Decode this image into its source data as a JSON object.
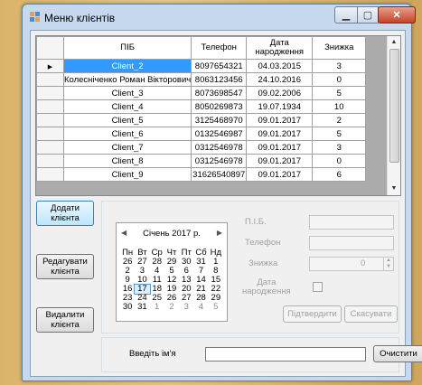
{
  "window": {
    "title": "Меню клієнтів"
  },
  "table": {
    "columns": [
      "ПІБ",
      "Телефон",
      "Дата\nнародження",
      "Знижка"
    ],
    "rows": [
      {
        "name": "Client_2",
        "phone": "8097654321",
        "birth": "04.03.2015",
        "discount": "3",
        "selected": true
      },
      {
        "name": "Колесніченко Роман Вікторович",
        "phone": "8063123456",
        "birth": "24.10.2016",
        "discount": "0"
      },
      {
        "name": "Client_3",
        "phone": "8073698547",
        "birth": "09.02.2006",
        "discount": "5"
      },
      {
        "name": "Client_4",
        "phone": "8050269873",
        "birth": "19.07.1934",
        "discount": "10"
      },
      {
        "name": "Client_5",
        "phone": "3125468970",
        "birth": "09.01.2017",
        "discount": "2"
      },
      {
        "name": "Client_6",
        "phone": "0132546987",
        "birth": "09.01.2017",
        "discount": "5"
      },
      {
        "name": "Client_7",
        "phone": "0312546978",
        "birth": "09.01.2017",
        "discount": "3"
      },
      {
        "name": "Client_8",
        "phone": "0312546978",
        "birth": "09.01.2017",
        "discount": "0"
      },
      {
        "name": "Client_9",
        "phone": "31626540897",
        "birth": "09.01.2017",
        "discount": "6"
      }
    ]
  },
  "buttons": {
    "add": "Додати\nклієнта",
    "edit": "Редагувати\nклієнта",
    "delete": "Видалити\nклієнта",
    "confirm": "Підтвердити",
    "cancel": "Скасувати",
    "clear": "Очистити"
  },
  "calendar": {
    "month": "Січень 2017 р.",
    "weekdays": [
      "Пн",
      "Вт",
      "Ср",
      "Чт",
      "Пт",
      "Сб",
      "Нд"
    ],
    "weeks": [
      [
        "26",
        "27",
        "28",
        "29",
        "30",
        "31",
        "1"
      ],
      [
        "2",
        "3",
        "4",
        "5",
        "6",
        "7",
        "8"
      ],
      [
        "9",
        "10",
        "11",
        "12",
        "13",
        "14",
        "15"
      ],
      [
        "16",
        "17",
        "18",
        "19",
        "20",
        "21",
        "22"
      ],
      [
        "23",
        "24",
        "25",
        "26",
        "27",
        "28",
        "29"
      ],
      [
        "30",
        "31",
        "1",
        "2",
        "3",
        "4",
        "5"
      ]
    ],
    "today": "17"
  },
  "form": {
    "pib_label": "П.І.Б.",
    "phone_label": "Телефон",
    "discount_label": "Знижка",
    "discount_value": "0",
    "birth_label": "Дата\nнародження"
  },
  "search": {
    "label": "Введіть ім'я",
    "value": ""
  },
  "colors": {
    "selection": "#3399ff",
    "window_frame": "#c7d9ee",
    "close_button": "#c4422a"
  },
  "icons": {
    "title": "app-icon",
    "row_pointer": "row-pointer-icon"
  }
}
